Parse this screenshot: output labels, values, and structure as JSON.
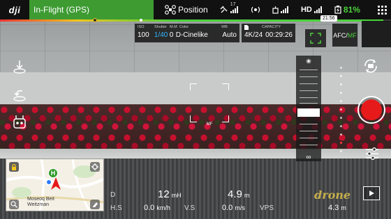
{
  "top_bar": {
    "logo": "dji",
    "flight_status": "In-Flight (GPS)",
    "flight_mode": "Position",
    "satellite_count": "17",
    "video_signal": "HD",
    "battery_percent": "81%",
    "battery_time": "21:56"
  },
  "battery_bar": {
    "level": 0.98
  },
  "camera": {
    "iso_label": "ISO",
    "iso_value": "100",
    "shutter_label": "Shutter",
    "shutter_value": "1/40",
    "mm_label": "M.M",
    "mm_value": "0",
    "color_label": "Color",
    "color_value": "D-Cinelike",
    "wb_label": "WB",
    "wb_value": "Auto",
    "capacity_label": "CAPACITY",
    "resolution": "4K/24",
    "capacity_value": "00:29:26",
    "afc_label": "AFC/",
    "mf_label": "MF",
    "focus_box_mode": "MF"
  },
  "focus_slider": {
    "bottom_symbol": "∞",
    "top_symbol": "❀"
  },
  "map": {
    "place_label": "Moseoq Beit Weitzman",
    "home_marker": "H"
  },
  "telemetry": {
    "d_label": "D",
    "d_value": "12",
    "d_unit": "mH",
    "h_value": "4.9",
    "h_unit": "m",
    "hs_label": "H.S",
    "hs_value": "0.0",
    "hs_unit": "km/h",
    "vs_label": "V.S",
    "vs_value": "0.0",
    "vs_unit": "m/s",
    "vps_label": "VPS",
    "vps_value": "4.3",
    "vps_unit": "m"
  },
  "watermark": "drone",
  "colors": {
    "status_green": "#3d9b32",
    "battery_green": "#4cd13b",
    "accent_blue": "#34b6ff",
    "record_red": "#e61a1a"
  }
}
